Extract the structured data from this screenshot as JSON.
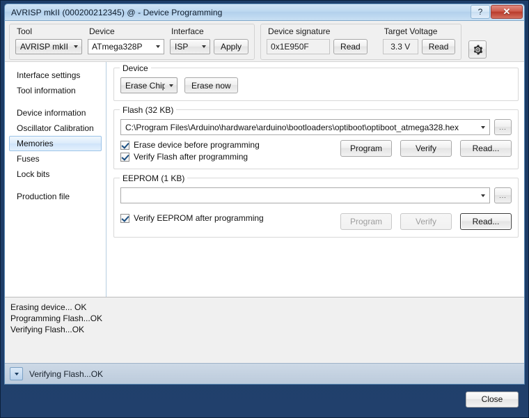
{
  "window": {
    "title": "AVRISP mkII (000200212345) @  - Device Programming",
    "help_label": "?",
    "close_label": "✕"
  },
  "toolbar": {
    "tool": {
      "label": "Tool",
      "value": "AVRISP mkII"
    },
    "device": {
      "label": "Device",
      "value": "ATmega328P"
    },
    "interface": {
      "label": "Interface",
      "value": "ISP"
    },
    "apply_label": "Apply",
    "signature": {
      "label": "Device signature",
      "value": "0x1E950F",
      "read_label": "Read"
    },
    "voltage": {
      "label": "Target Voltage",
      "value": "3.3 V",
      "read_label": "Read"
    },
    "settings_icon": "gear-icon"
  },
  "sidebar": {
    "items": [
      {
        "label": "Interface settings",
        "selected": false
      },
      {
        "label": "Tool information",
        "selected": false
      },
      {
        "label": "Device information",
        "selected": false
      },
      {
        "label": "Oscillator Calibration",
        "selected": false
      },
      {
        "label": "Memories",
        "selected": true
      },
      {
        "label": "Fuses",
        "selected": false
      },
      {
        "label": "Lock bits",
        "selected": false
      },
      {
        "label": "Production file",
        "selected": false
      }
    ]
  },
  "device_group": {
    "legend": "Device",
    "erase_mode": "Erase Chip",
    "erase_now_label": "Erase now"
  },
  "flash_group": {
    "legend": "Flash (32 KB)",
    "file_path": "C:\\Program Files\\Arduino\\hardware\\arduino\\bootloaders\\optiboot\\optiboot_atmega328.hex",
    "browse_label": "...",
    "check_erase": "Erase device before programming",
    "check_verify": "Verify Flash after programming",
    "program_label": "Program",
    "verify_label": "Verify",
    "read_label": "Read..."
  },
  "eeprom_group": {
    "legend": "EEPROM (1 KB)",
    "file_path": "",
    "browse_label": "...",
    "check_verify": "Verify EEPROM after programming",
    "program_label": "Program",
    "verify_label": "Verify",
    "read_label": "Read..."
  },
  "log": {
    "lines": "Erasing device... OK\nProgramming Flash...OK\nVerifying Flash...OK"
  },
  "statusbar": {
    "message": "Verifying Flash...OK"
  },
  "footer": {
    "close_label": "Close"
  },
  "colors": {
    "frame": "#1f3f6b",
    "accent_selected": "#9cc4e8",
    "close_red": "#b93b2c",
    "status_bg": "#bccbdc"
  }
}
